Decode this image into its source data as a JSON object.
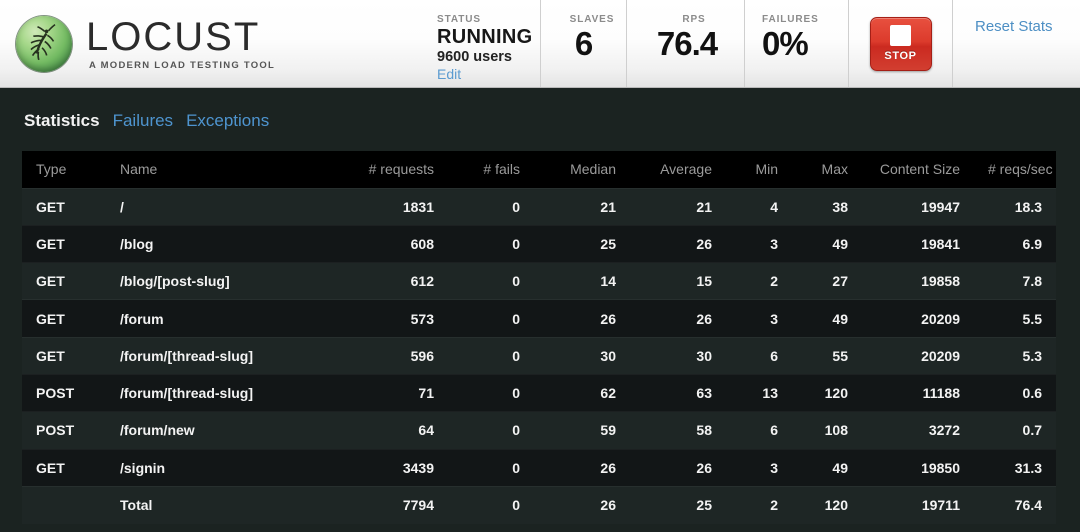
{
  "header": {
    "logo": {
      "icon": "locust-logo-icon",
      "title": "LOCUST",
      "tagline": "A MODERN LOAD TESTING TOOL"
    },
    "stats": [
      {
        "label": "STATUS",
        "value": "RUNNING",
        "users": "9600 users",
        "edit_label": "Edit"
      },
      {
        "label": "SLAVES",
        "value": "6"
      },
      {
        "label": "RPS",
        "value": "76.4"
      },
      {
        "label": "FAILURES",
        "value": "0%"
      }
    ],
    "stop_button": {
      "label": "STOP",
      "icon": "stop-square-icon"
    },
    "reset_label": "Reset Stats"
  },
  "tabs": [
    {
      "label": "Statistics",
      "active": true
    },
    {
      "label": "Failures",
      "active": false
    },
    {
      "label": "Exceptions",
      "active": false
    }
  ],
  "table": {
    "columns": [
      {
        "label": "Type",
        "align": "l"
      },
      {
        "label": "Name",
        "align": "l"
      },
      {
        "label": "# requests",
        "align": "r"
      },
      {
        "label": "# fails",
        "align": "r"
      },
      {
        "label": "Median",
        "align": "r"
      },
      {
        "label": "Average",
        "align": "r"
      },
      {
        "label": "Min",
        "align": "r"
      },
      {
        "label": "Max",
        "align": "r"
      },
      {
        "label": "Content Size",
        "align": "r"
      },
      {
        "label": "# reqs/sec",
        "align": "r"
      }
    ],
    "rows": [
      {
        "type": "GET",
        "name": "/",
        "requests": "1831",
        "fails": "0",
        "median": "21",
        "average": "21",
        "min": "4",
        "max": "38",
        "content_size": "19947",
        "reqs_sec": "18.3"
      },
      {
        "type": "GET",
        "name": "/blog",
        "requests": "608",
        "fails": "0",
        "median": "25",
        "average": "26",
        "min": "3",
        "max": "49",
        "content_size": "19841",
        "reqs_sec": "6.9"
      },
      {
        "type": "GET",
        "name": "/blog/[post-slug]",
        "requests": "612",
        "fails": "0",
        "median": "14",
        "average": "15",
        "min": "2",
        "max": "27",
        "content_size": "19858",
        "reqs_sec": "7.8"
      },
      {
        "type": "GET",
        "name": "/forum",
        "requests": "573",
        "fails": "0",
        "median": "26",
        "average": "26",
        "min": "3",
        "max": "49",
        "content_size": "20209",
        "reqs_sec": "5.5"
      },
      {
        "type": "GET",
        "name": "/forum/[thread-slug]",
        "requests": "596",
        "fails": "0",
        "median": "30",
        "average": "30",
        "min": "6",
        "max": "55",
        "content_size": "20209",
        "reqs_sec": "5.3"
      },
      {
        "type": "POST",
        "name": "/forum/[thread-slug]",
        "requests": "71",
        "fails": "0",
        "median": "62",
        "average": "63",
        "min": "13",
        "max": "120",
        "content_size": "11188",
        "reqs_sec": "0.6"
      },
      {
        "type": "POST",
        "name": "/forum/new",
        "requests": "64",
        "fails": "0",
        "median": "59",
        "average": "58",
        "min": "6",
        "max": "108",
        "content_size": "3272",
        "reqs_sec": "0.7"
      },
      {
        "type": "GET",
        "name": "/signin",
        "requests": "3439",
        "fails": "0",
        "median": "26",
        "average": "26",
        "min": "3",
        "max": "49",
        "content_size": "19850",
        "reqs_sec": "31.3"
      }
    ],
    "total_row": {
      "type": "",
      "name": "Total",
      "requests": "7794",
      "fails": "0",
      "median": "26",
      "average": "25",
      "min": "2",
      "max": "120",
      "content_size": "19711",
      "reqs_sec": "76.4"
    }
  },
  "colors": {
    "page_bg": "#1b2321",
    "link_blue": "#4e94cf",
    "stop_red": "#d6372a",
    "logo_green": "#74bb63"
  }
}
